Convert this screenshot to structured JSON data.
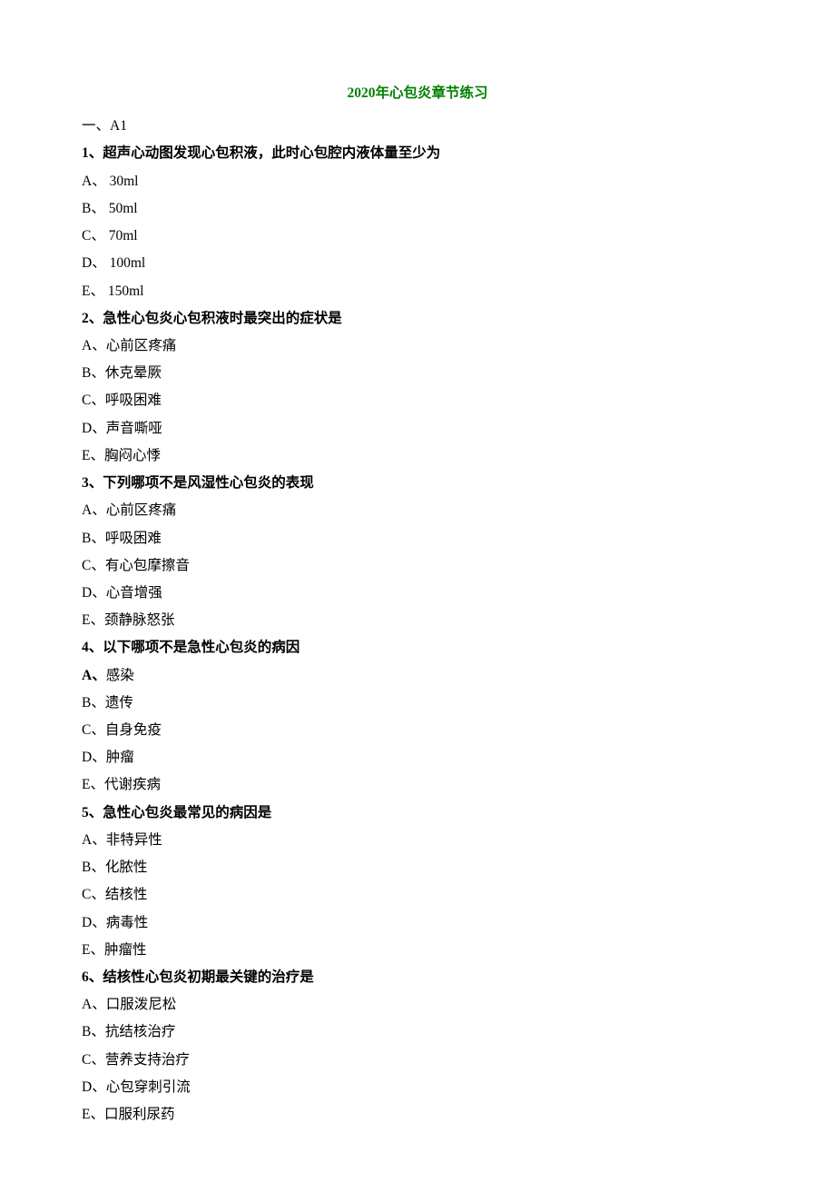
{
  "title": "2020年心包炎章节练习",
  "section_label": "一、A1",
  "questions": [
    {
      "num": "1",
      "stem": "、超声心动图发现心包积液，此时心包腔内液体量至少为",
      "options": [
        {
          "p": "A、",
          "t": " 30ml"
        },
        {
          "p": "B、",
          "t": " 50ml"
        },
        {
          "p": "C、",
          "t": " 70ml"
        },
        {
          "p": "D、",
          "t": " 100ml"
        },
        {
          "p": "E、",
          "t": " 150ml"
        }
      ]
    },
    {
      "num": "2",
      "stem": "、急性心包炎心包积液时最突出的症状是",
      "options": [
        {
          "p": "A、",
          "t": "心前区疼痛"
        },
        {
          "p": "B、",
          "t": "休克晕厥"
        },
        {
          "p": "C、",
          "t": "呼吸困难"
        },
        {
          "p": "D、",
          "t": "声音嘶哑"
        },
        {
          "p": "E、",
          "t": "胸闷心悸"
        }
      ]
    },
    {
      "num": "3",
      "stem": "、下列哪项不是风湿性心包炎的表现",
      "options": [
        {
          "p": "A、",
          "t": "心前区疼痛"
        },
        {
          "p": "B、",
          "t": "呼吸困难"
        },
        {
          "p": "C、",
          "t": "有心包摩擦音"
        },
        {
          "p": "D、",
          "t": "心音增强"
        },
        {
          "p": "E、",
          "t": "颈静脉怒张"
        }
      ]
    },
    {
      "num": "4",
      "stem": "、以下哪项不是急性心包炎的病因",
      "a_bold": true,
      "options": [
        {
          "p": "A、",
          "t": "感染",
          "bold_a": true
        },
        {
          "p": "B、",
          "t": "遗传"
        },
        {
          "p": "C、",
          "t": "自身免疫"
        },
        {
          "p": "D、",
          "t": "肿瘤"
        },
        {
          "p": "E、",
          "t": "代谢疾病"
        }
      ]
    },
    {
      "num": "5",
      "stem": "、急性心包炎最常见的病因是",
      "options": [
        {
          "p": "A、",
          "t": "非特异性"
        },
        {
          "p": "B、",
          "t": "化脓性"
        },
        {
          "p": "C、",
          "t": "结核性"
        },
        {
          "p": "D、",
          "t": "病毒性"
        },
        {
          "p": "E、",
          "t": "肿瘤性"
        }
      ]
    },
    {
      "num": "6",
      "stem": "、结核性心包炎初期最关键的治疗是",
      "options": [
        {
          "p": "A、",
          "t": "口服泼尼松"
        },
        {
          "p": "B、",
          "t": "抗结核治疗"
        },
        {
          "p": "C、",
          "t": "营养支持治疗"
        },
        {
          "p": "D、",
          "t": "心包穿刺引流"
        },
        {
          "p": "E、",
          "t": "口服利尿药"
        }
      ]
    }
  ]
}
